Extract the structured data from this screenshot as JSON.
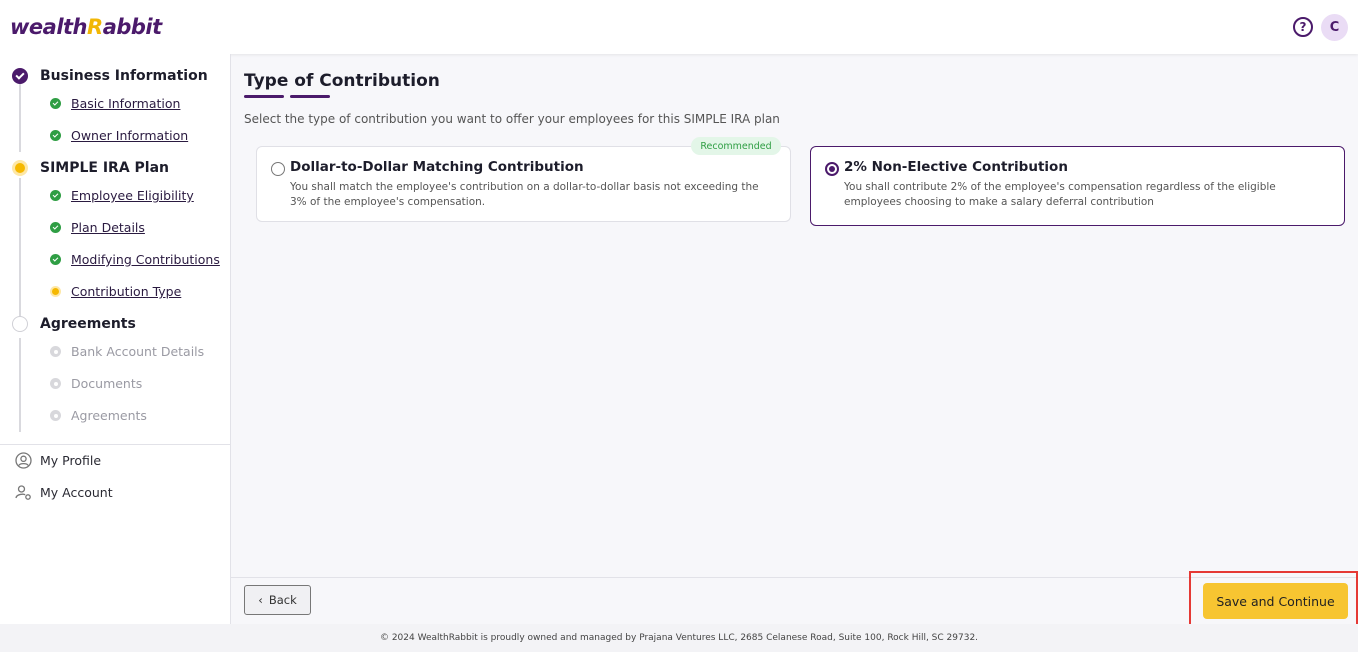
{
  "app": {
    "logo_text": "wealthRabbit",
    "avatar_initial": "C"
  },
  "sidebar": {
    "steps": [
      {
        "label": "Business Information",
        "status": "done",
        "items": [
          {
            "label": "Basic Information",
            "status": "done"
          },
          {
            "label": "Owner Information",
            "status": "done"
          }
        ]
      },
      {
        "label": "SIMPLE IRA Plan",
        "status": "current",
        "items": [
          {
            "label": "Employee Eligibility",
            "status": "done"
          },
          {
            "label": "Plan Details",
            "status": "done"
          },
          {
            "label": "Modifying Contributions",
            "status": "done"
          },
          {
            "label": "Contribution Type",
            "status": "current"
          }
        ]
      },
      {
        "label": "Agreements",
        "status": "todo",
        "items": [
          {
            "label": "Bank Account Details",
            "status": "todo"
          },
          {
            "label": "Documents",
            "status": "todo"
          },
          {
            "label": "Agreements",
            "status": "todo"
          }
        ]
      }
    ],
    "nav": [
      {
        "label": "My Profile",
        "icon": "profile-icon"
      },
      {
        "label": "My Account",
        "icon": "account-settings-icon"
      }
    ]
  },
  "main": {
    "title": "Type of Contribution",
    "subtitle": "Select the type of contribution you want to offer your employees for this SIMPLE IRA plan",
    "options": [
      {
        "title": "Dollar-to-Dollar Matching Contribution",
        "description": "You shall match the employee's contribution on a dollar-to-dollar basis not exceeding the 3% of the employee's compensation.",
        "badge": "Recommended",
        "selected": false
      },
      {
        "title": "2% Non-Elective Contribution",
        "description": "You shall contribute 2% of the employee's compensation regardless of the eligible employees choosing to make a salary deferral contribution",
        "selected": true
      }
    ]
  },
  "footer": {
    "back_label": "Back",
    "save_label": "Save and Continue",
    "copyright": "© 2024 WealthRabbit is proudly owned and managed by Prajana Ventures LLC, 2685 Celanese Road, Suite 100, Rock Hill, SC 29732."
  },
  "colors": {
    "brand_purple": "#4b1a6b",
    "brand_yellow": "#f7c531",
    "success_green": "#2f9e44"
  }
}
